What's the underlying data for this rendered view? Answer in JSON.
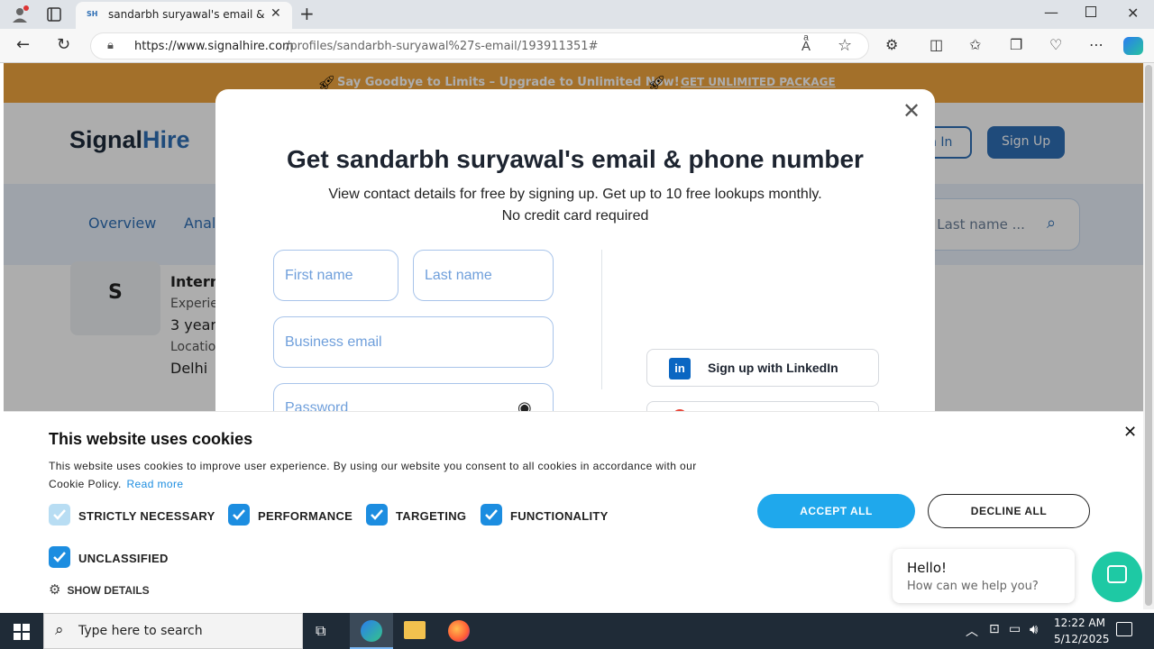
{
  "browser": {
    "tab_title": "sandarbh suryawal's email & pho",
    "tab_favicon": "SH",
    "url_host": "https://www.signalhire.com",
    "url_path": "/profiles/sandarbh-suryawal%27s-email/193911351#"
  },
  "page": {
    "promo_text": "Say Goodbye to Limits – Upgrade to Unlimited Now!",
    "promo_link": "GET UNLIMITED PACKAGE",
    "logo_signal": "Signal",
    "logo_hire": "Hire",
    "login_partial": "n In",
    "signup_button": "Sign Up",
    "nav_overview": "Overview",
    "nav_analytics_partial": "Anal",
    "search_placeholder_partial": "d Last name ...",
    "avatar_letter": "S",
    "profile": {
      "title_partial": "Intern",
      "experience_label_partial": "Experie",
      "experience_value_partial": "3 year",
      "location_label_partial": "Locatio",
      "location_value": "Delhi"
    }
  },
  "modal": {
    "title": "Get sandarbh suryawal's email & phone number",
    "subtitle_line1": "View contact details for free by signing up. Get up to 10 free lookups monthly.",
    "subtitle_line2": "No credit card required",
    "first_name_placeholder": "First name",
    "last_name_placeholder": "Last name",
    "email_placeholder": "Business email",
    "password_placeholder": "Password",
    "linkedin_button": "Sign up with LinkedIn"
  },
  "cookie": {
    "title": "This website uses cookies",
    "body": "This website uses cookies to improve user experience. By using our website you consent to all cookies in accordance with our",
    "body2": "Cookie Policy.",
    "read_more": "Read more",
    "options": [
      "STRICTLY NECESSARY",
      "PERFORMANCE",
      "TARGETING",
      "FUNCTIONALITY",
      "UNCLASSIFIED"
    ],
    "show_details": "SHOW DETAILS",
    "accept_all": "ACCEPT ALL",
    "decline_all": "DECLINE ALL"
  },
  "chat": {
    "hello": "Hello!",
    "help": "How can we help you?"
  },
  "taskbar": {
    "search_placeholder": "Type here to search",
    "time": "12:22 AM",
    "date": "5/12/2025"
  },
  "colors": {
    "brand_blue": "#2f6fb5",
    "promo_orange": "#f1a63f",
    "accept_blue": "#1fa8ec",
    "chat_teal": "#1ec9a4"
  }
}
